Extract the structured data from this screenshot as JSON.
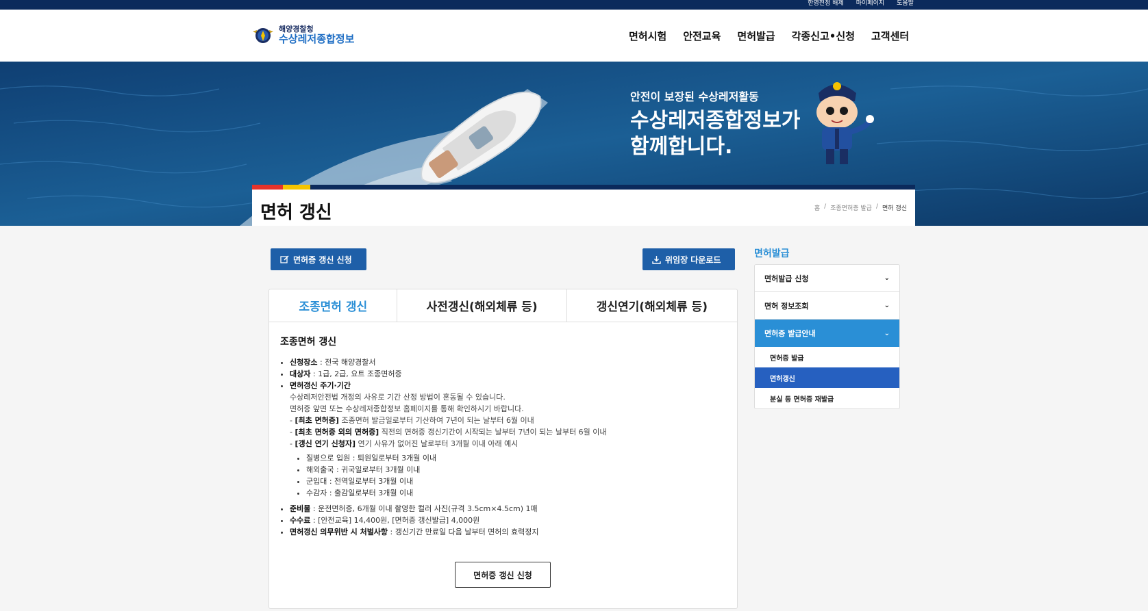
{
  "util_links": [
    "한영전정 해제",
    "마이페이지",
    "도움말"
  ],
  "logo": {
    "sub": "해양경찰청",
    "main": "수상레저종합정보"
  },
  "gnb": [
    "면허시험",
    "안전교육",
    "면허발급",
    "각종신고•신청",
    "고객센터"
  ],
  "banner": {
    "small": "안전이 보장된 수상레저활동",
    "line1": "수상레저종합정보가",
    "line2": "함께합니다."
  },
  "page": {
    "title": "면허 갱신",
    "breadcrumb": [
      "홈",
      "조종면허증 발급",
      "면허 갱신"
    ]
  },
  "buttons": {
    "apply_top": "면허증 갱신 신청",
    "download": "위임장 다운로드",
    "apply_bottom": "면허증 갱신 신청"
  },
  "tabs": [
    "조종면허 갱신",
    "사전갱신(해외체류 등)",
    "갱신연기(해외체류 등)"
  ],
  "content": {
    "heading": "조종면허 갱신",
    "place_label": "신청장소",
    "place_value": " : 전국 해양경찰서",
    "target_label": "대상자",
    "target_value": " : 1급, 2급, 요트 조종면허증",
    "period_label": "면허갱신 주기·기간",
    "period_note1": "수상레저안전법 개정의 사유로 기간 산정 방법이 혼동될 수 있습니다.",
    "period_note2": "면허증 앞면 또는 수상레저종합정보 홈페이지를 통해 확인하시기 바랍니다.",
    "dash1_label": "[최초 면허증]",
    "dash1_value": " 조종면허 발급일로부터 기산하여 7년이 되는 날부터 6월 이내",
    "dash2_label": "[최초 면허증 외의 면허증]",
    "dash2_value": " 직전의 면허증 갱신기간이 시작되는 날부터 7년이 되는 날부터 6월 이내",
    "dash3_label": "[갱신 연기 신청자]",
    "dash3_value": " 연기 사유가 없어진 날로부터 3개월 이내 아래 예시",
    "examples": [
      "질병으로 입원 : 퇴원일로부터 3개월 이내",
      "해외출국 : 귀국일로부터 3개월 이내",
      "군입대 : 전역일로부터 3개월 이내",
      "수감자 : 출감일로부터 3개월 이내"
    ],
    "prep_label": "준비물",
    "prep_value": " : 운전면허증, 6개월 이내 촬영한 컬러 사진(규격 3.5cm×4.5cm) 1매",
    "fee_label": "수수료",
    "fee_value": " : [안전교육] 14,400원, [면허증 갱신발급] 4,000원",
    "penalty_label": "면허갱신 의무위반 시 처벌사항",
    "penalty_value": " : 갱신기간 만료일 다음 날부터 면허의 효력정지"
  },
  "sidebar": {
    "title": "면허발급",
    "items": [
      "면허발급 신청",
      "면허 정보조회",
      "면허증 발급안내"
    ],
    "subitems": [
      "면허증 발급",
      "면허갱신",
      "분실 등 면허증 재발급"
    ]
  },
  "colors": {
    "navy": "#0b2a5c",
    "accent": "#2a8fd6",
    "button": "#1e5fa8",
    "active_sub": "#2660c0"
  }
}
